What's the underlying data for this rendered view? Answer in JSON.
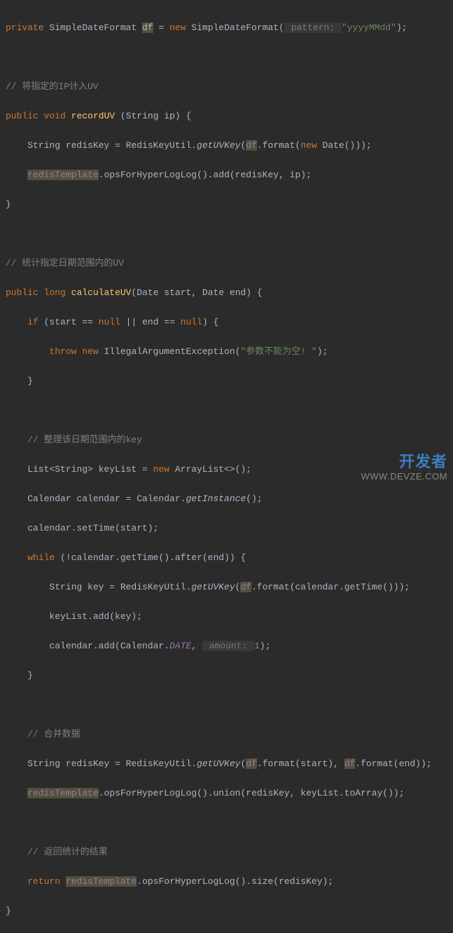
{
  "line1": {
    "kw_private": "private",
    "type": "SimpleDateFormat",
    "var": "df",
    "eq": " = ",
    "kw_new": "new",
    "ctor": "SimpleDateFormat",
    "hint_pattern": " pattern: ",
    "str_pattern": "\"yyyyMMdd\"",
    "end": ");"
  },
  "cmt1": "// 将指定的IP计入UV",
  "sig1": {
    "kw_public": "public",
    "kw_void": "void",
    "name": "recordUV",
    "params_open": " (String ip) {"
  },
  "body1a": {
    "pre": "    String redisKey = RedisKeyUtil.",
    "call": "getUVKey",
    "open": "(",
    "df": "df",
    "fmt": ".format(",
    "kw_new": "new",
    "date": " Date()));"
  },
  "body1b": {
    "tpl": "redisTemplate",
    "chain": ".opsForHyperLogLog().add(redisKey, ip);"
  },
  "close1": "}",
  "cmt2": "// 统计指定日期范围内的UV",
  "sig2": {
    "kw_public": "public",
    "kw_long": "long",
    "name": "calculateUV",
    "params": "(Date start, Date end) {"
  },
  "if_line": {
    "kw_if": "if",
    "cond_open": " (start == ",
    "null1": "null",
    "or": " || end == ",
    "null2": "null",
    "close": ") {"
  },
  "throw_line": {
    "kw_throw": "throw",
    "sp": " ",
    "kw_new": "new",
    "ex": " IllegalArgumentException(",
    "msg": "\"参数不能为空! \"",
    "end": ");"
  },
  "close_if": "    }",
  "cmt3": "    // 整理该日期范围内的key",
  "list_line": {
    "pre": "    List<String> keyList = ",
    "kw_new": "new",
    "post": " ArrayList<>();"
  },
  "cal_line": {
    "pre": "    Calendar calendar = Calendar.",
    "call": "getInstance",
    "end": "();"
  },
  "settime": "    calendar.setTime(start);",
  "while_line": {
    "kw_while": "while",
    "cond": " (!calendar.getTime().after(end)) {"
  },
  "key_line": {
    "pre": "        String key = RedisKeyUtil.",
    "call": "getUVKey",
    "open": "(",
    "df": "df",
    "post": ".format(calendar.getTime()));"
  },
  "add_line": "        keyList.add(key);",
  "caladd_line": {
    "pre": "        calendar.add(Calendar.",
    "const": "DATE",
    "comma": ", ",
    "hint": " amount: ",
    "num": "1",
    "end": ");"
  },
  "close_while": "    }",
  "cmt4": "    // 合并数据",
  "rk2_line": {
    "pre": "    String redisKey = RedisKeyUtil.",
    "call": "getUVKey",
    "open": "(",
    "df1": "df",
    "mid": ".format(start), ",
    "df2": "df",
    "end": ".format(end));"
  },
  "union_line": {
    "tpl": "redisTemplate",
    "chain": ".opsForHyperLogLog().union(redisKey, keyList.toArray());"
  },
  "cmt5": "    // 返回统计的结果",
  "ret_line": {
    "kw_return": "return",
    "sp": " ",
    "tpl": "redisTemplate",
    "chain": ".opsForHyperLogLog().size(redisKey);"
  },
  "close2": "}",
  "watermark": {
    "top": "开发者",
    "bot": "WWW.DEVZE.COM"
  }
}
